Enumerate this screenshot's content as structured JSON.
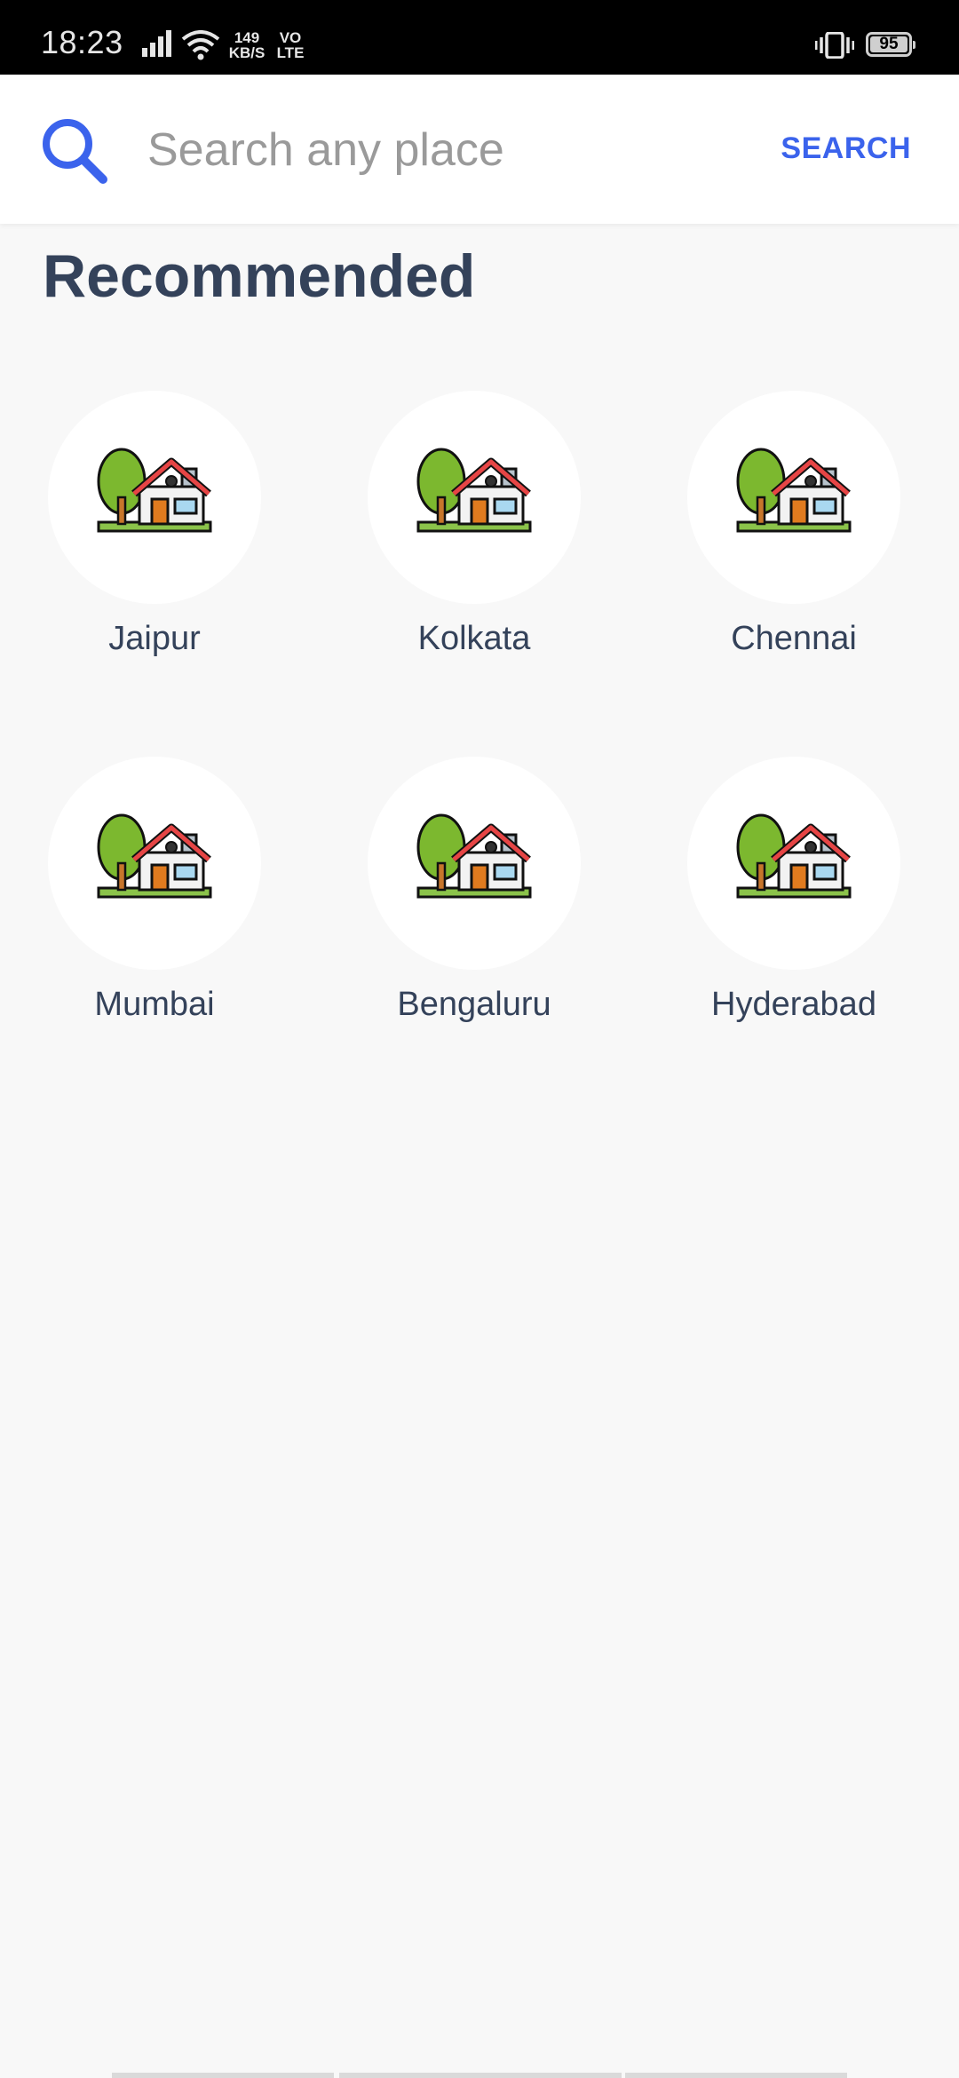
{
  "status_bar": {
    "time": "18:23",
    "net_speed_value": "149",
    "net_speed_unit": "KB/S",
    "volte_top": "VO",
    "volte_bottom": "LTE",
    "battery": "95"
  },
  "search": {
    "placeholder": "Search any place",
    "value": "",
    "button_label": "SEARCH"
  },
  "recommended": {
    "title": "Recommended",
    "places": [
      {
        "name": "Jaipur"
      },
      {
        "name": "Kolkata"
      },
      {
        "name": "Chennai"
      },
      {
        "name": "Mumbai"
      },
      {
        "name": "Bengaluru"
      },
      {
        "name": "Hyderabad"
      }
    ]
  },
  "colors": {
    "accent": "#3b63ec",
    "title_text": "#34425a",
    "background": "#f8f8f8"
  }
}
